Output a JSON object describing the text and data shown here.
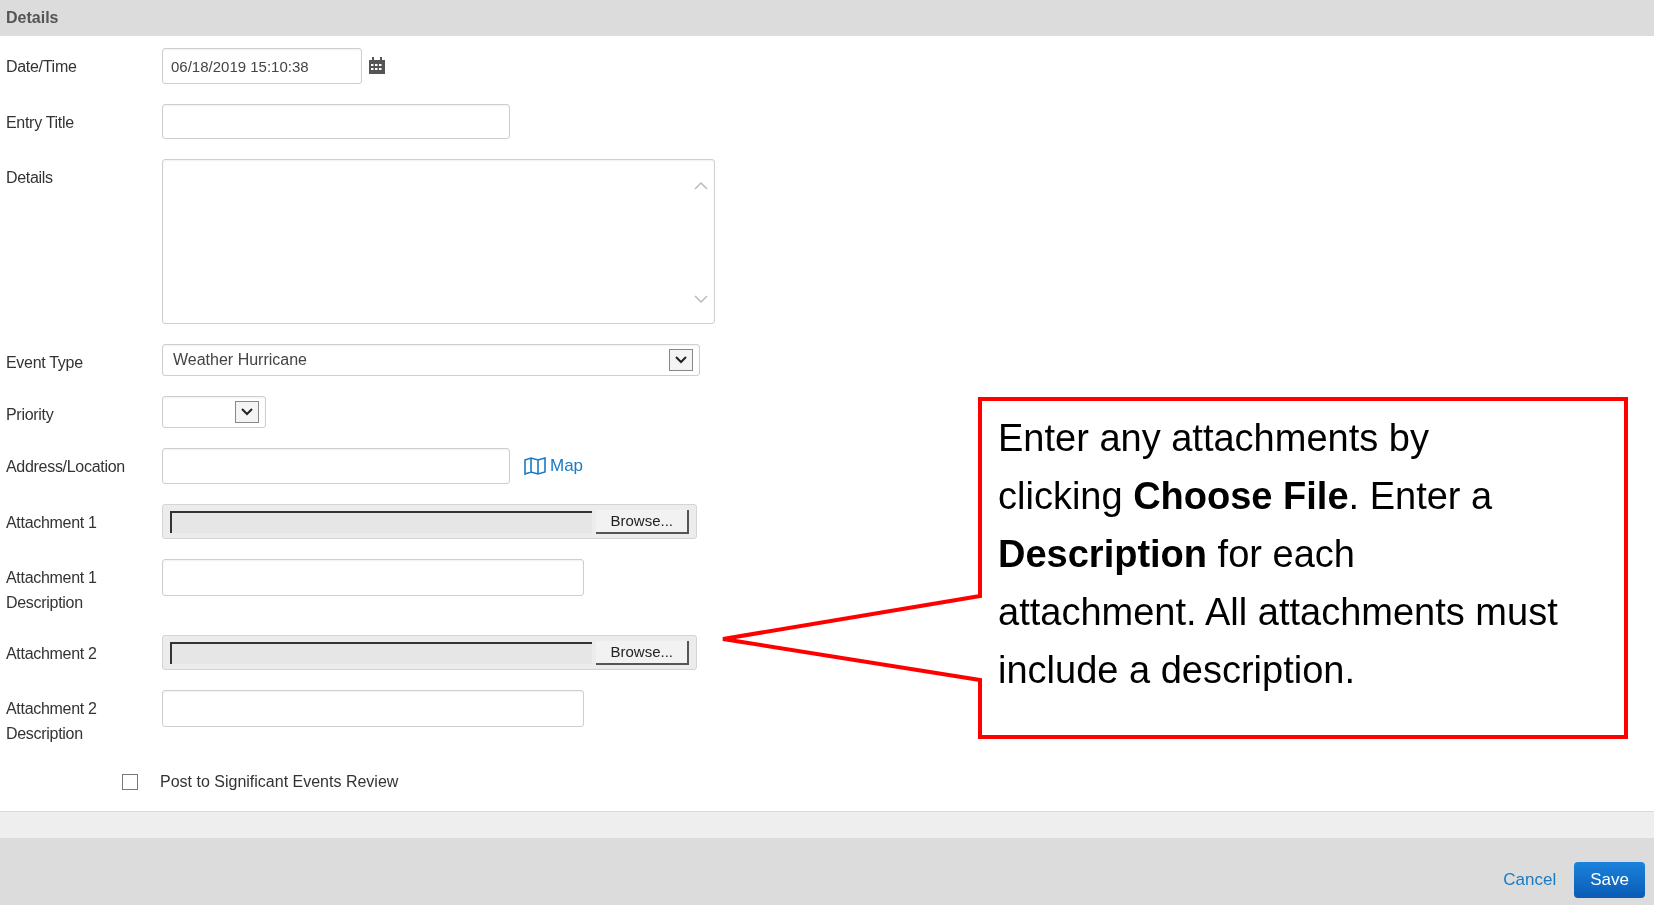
{
  "section_title": "Details",
  "fields": [
    {
      "kind": "date",
      "label": "Date/Time",
      "value": "06/18/2019 15:10:38"
    },
    {
      "kind": "text",
      "label": "Entry Title"
    },
    {
      "kind": "textarea",
      "label": "Details"
    },
    {
      "kind": "select",
      "label": "Event Type",
      "value": "Weather Hurricane"
    },
    {
      "kind": "select_small",
      "label": "Priority"
    },
    {
      "kind": "address",
      "label": "Address/Location",
      "link": "Map"
    },
    {
      "kind": "file",
      "label": "Attachment 1",
      "button": "Browse..."
    },
    {
      "kind": "text_medium",
      "label": "Attachment 1 Description"
    },
    {
      "kind": "file",
      "label": "Attachment 2",
      "button": "Browse..."
    },
    {
      "kind": "text_medium",
      "label": "Attachment 2 Description"
    }
  ],
  "checkbox": {
    "label": "Post to Significant Events Review",
    "checked": false
  },
  "footer_buttons": [
    {
      "kind": "link",
      "label": "Cancel"
    },
    {
      "kind": "primary",
      "label": "Save"
    }
  ],
  "callout": {
    "text": "Enter any attachments by clicking **Choose File**. Enter a **Description** for each attachment. All attachments must include a description."
  }
}
